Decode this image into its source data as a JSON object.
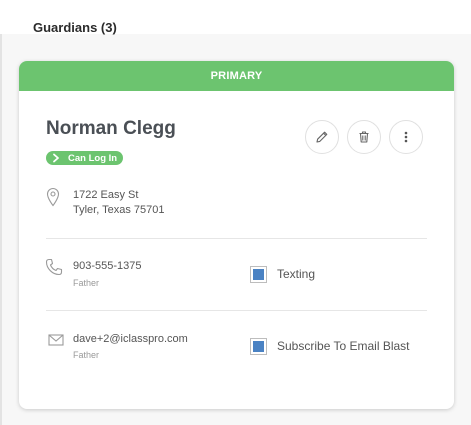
{
  "section": {
    "title": "Guardians (3)"
  },
  "card": {
    "header": "PRIMARY",
    "name": "Norman Clegg",
    "badge": "Can Log In",
    "actions": [
      "pencil-icon",
      "trash-icon",
      "more-vertical-icon"
    ],
    "address": {
      "line1": "1722 Easy St",
      "line2": "Tyler, Texas 75701"
    },
    "phone": {
      "value": "903-555-1375",
      "relation": "Father",
      "option_label": "Texting",
      "option_checked": true
    },
    "email": {
      "value": "dave+2@iclasspro.com",
      "relation": "Father",
      "option_label": "Subscribe To Email Blast",
      "option_checked": true
    }
  },
  "colors": {
    "accent": "#6cc46f",
    "checkbox": "#4a82c3"
  }
}
